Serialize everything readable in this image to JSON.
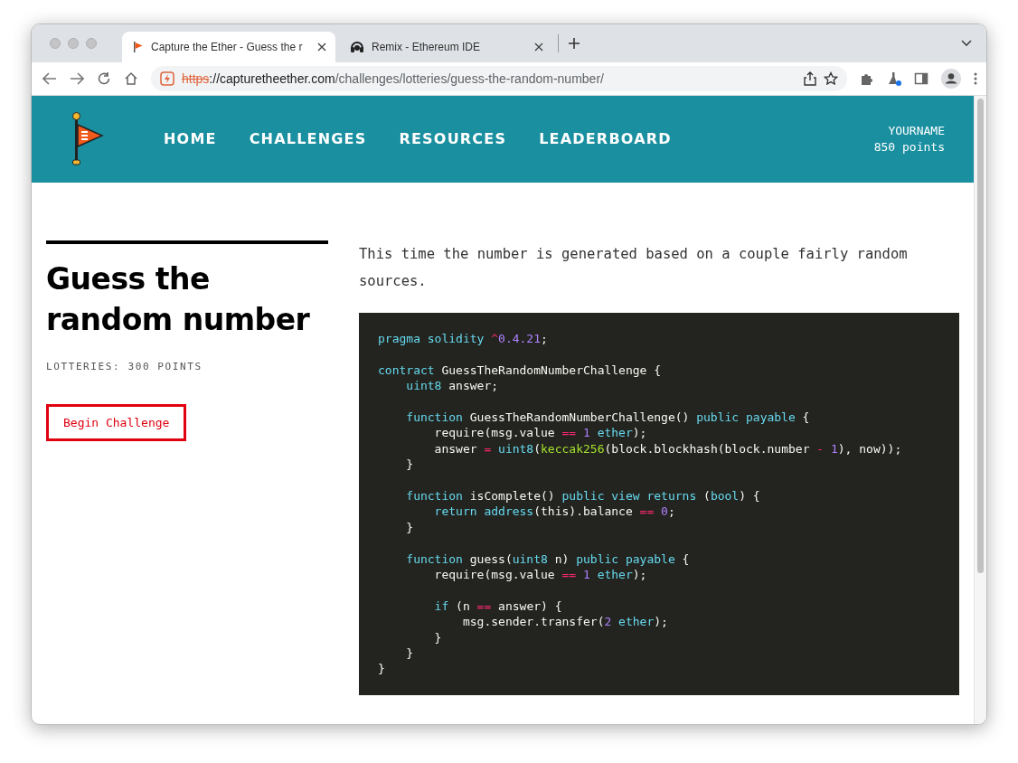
{
  "browser": {
    "tabs": [
      {
        "title": "Capture the Ether - Guess the r",
        "selected": true
      },
      {
        "title": "Remix - Ethereum IDE",
        "selected": false
      }
    ],
    "address": {
      "scheme": "https",
      "host": "://capturetheether.com",
      "path": "/challenges/lotteries/guess-the-random-number/"
    }
  },
  "header": {
    "nav": [
      "HOME",
      "CHALLENGES",
      "RESOURCES",
      "LEADERBOARD"
    ],
    "user": {
      "name": "YOURNAME",
      "points": "850 points"
    }
  },
  "challenge": {
    "title": "Guess the random number",
    "category": "LOTTERIES: 300 POINTS",
    "button": "Begin Challenge"
  },
  "intro": "This time the number is generated based on a couple fairly random sources.",
  "code_lines": [
    {
      "kind": "code",
      "parts": [
        {
          "kind": "kw",
          "text": "pragma solidity "
        },
        {
          "kind": "op",
          "text": "^"
        },
        {
          "kind": "num",
          "text": "0.4.21"
        },
        {
          "kind": "p",
          "text": ";"
        }
      ]
    },
    {
      "kind": "blank"
    },
    {
      "kind": "code",
      "parts": [
        {
          "kind": "kw",
          "text": "contract"
        },
        {
          "kind": "p",
          "text": " GuessTheRandomNumberChallenge {"
        }
      ]
    },
    {
      "kind": "code",
      "parts": [
        {
          "kind": "kw",
          "text": "    uint8"
        },
        {
          "kind": "p",
          "text": " answer;"
        }
      ]
    },
    {
      "kind": "blank"
    },
    {
      "kind": "code",
      "parts": [
        {
          "kind": "kw",
          "text": "    function"
        },
        {
          "kind": "p",
          "text": " GuessTheRandomNumberChallenge() "
        },
        {
          "kind": "kw",
          "text": "public payable"
        },
        {
          "kind": "p",
          "text": " {"
        }
      ]
    },
    {
      "kind": "code",
      "parts": [
        {
          "kind": "p",
          "text": "        require(msg.value "
        },
        {
          "kind": "op",
          "text": "=="
        },
        {
          "kind": "num",
          "text": " 1"
        },
        {
          "kind": "kw",
          "text": " ether"
        },
        {
          "kind": "p",
          "text": ");"
        }
      ]
    },
    {
      "kind": "code",
      "parts": [
        {
          "kind": "p",
          "text": "        answer "
        },
        {
          "kind": "op",
          "text": "="
        },
        {
          "kind": "kw",
          "text": " uint8"
        },
        {
          "kind": "p",
          "text": "("
        },
        {
          "kind": "fn",
          "text": "keccak256"
        },
        {
          "kind": "p",
          "text": "(block.blockhash(block.number "
        },
        {
          "kind": "op",
          "text": "-"
        },
        {
          "kind": "num",
          "text": " 1"
        },
        {
          "kind": "p",
          "text": "), now));"
        }
      ]
    },
    {
      "kind": "code",
      "parts": [
        {
          "kind": "p",
          "text": "    }"
        }
      ]
    },
    {
      "kind": "blank"
    },
    {
      "kind": "code",
      "parts": [
        {
          "kind": "kw",
          "text": "    function"
        },
        {
          "kind": "p",
          "text": " isComplete() "
        },
        {
          "kind": "kw",
          "text": "public view returns"
        },
        {
          "kind": "p",
          "text": " ("
        },
        {
          "kind": "kw",
          "text": "bool"
        },
        {
          "kind": "p",
          "text": ") {"
        }
      ]
    },
    {
      "kind": "code",
      "parts": [
        {
          "kind": "kw",
          "text": "        return address"
        },
        {
          "kind": "p",
          "text": "(this).balance "
        },
        {
          "kind": "op",
          "text": "=="
        },
        {
          "kind": "num",
          "text": " 0"
        },
        {
          "kind": "p",
          "text": ";"
        }
      ]
    },
    {
      "kind": "code",
      "parts": [
        {
          "kind": "p",
          "text": "    }"
        }
      ]
    },
    {
      "kind": "blank"
    },
    {
      "kind": "code",
      "parts": [
        {
          "kind": "kw",
          "text": "    function"
        },
        {
          "kind": "p",
          "text": " guess("
        },
        {
          "kind": "kw",
          "text": "uint8"
        },
        {
          "kind": "p",
          "text": " n) "
        },
        {
          "kind": "kw",
          "text": "public payable"
        },
        {
          "kind": "p",
          "text": " {"
        }
      ]
    },
    {
      "kind": "code",
      "parts": [
        {
          "kind": "p",
          "text": "        require(msg.value "
        },
        {
          "kind": "op",
          "text": "=="
        },
        {
          "kind": "num",
          "text": " 1"
        },
        {
          "kind": "kw",
          "text": " ether"
        },
        {
          "kind": "p",
          "text": ");"
        }
      ]
    },
    {
      "kind": "blank"
    },
    {
      "kind": "code",
      "parts": [
        {
          "kind": "kw",
          "text": "        if"
        },
        {
          "kind": "p",
          "text": " (n "
        },
        {
          "kind": "op",
          "text": "=="
        },
        {
          "kind": "p",
          "text": " answer) {"
        }
      ]
    },
    {
      "kind": "code",
      "parts": [
        {
          "kind": "p",
          "text": "            msg.sender.transfer("
        },
        {
          "kind": "num",
          "text": "2"
        },
        {
          "kind": "kw",
          "text": " ether"
        },
        {
          "kind": "p",
          "text": ");"
        }
      ]
    },
    {
      "kind": "code",
      "parts": [
        {
          "kind": "p",
          "text": "        }"
        }
      ]
    },
    {
      "kind": "code",
      "parts": [
        {
          "kind": "p",
          "text": "    }"
        }
      ]
    },
    {
      "kind": "code",
      "parts": [
        {
          "kind": "p",
          "text": "}"
        }
      ]
    }
  ]
}
